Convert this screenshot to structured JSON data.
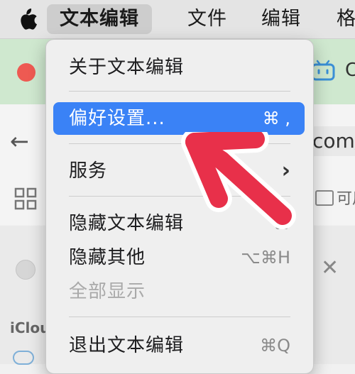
{
  "menubar": {
    "items": [
      "文本编辑",
      "文件",
      "编辑",
      "格"
    ]
  },
  "background": {
    "tab_text": "C",
    "url_text": "com/",
    "available_text": "可用"
  },
  "sidebar": {
    "icloud_label": "iClou"
  },
  "menu": {
    "about": "关于文本编辑",
    "preferences": "偏好设置...",
    "preferences_shortcut": "⌘ ,",
    "services": "服务",
    "services_chevron": "›",
    "hide_app": "隐藏文本编辑",
    "hide_app_shortcut": "⌘",
    "hide_others": "隐藏其他",
    "hide_others_shortcut": "⌥⌘H",
    "show_all": "全部显示",
    "quit": "退出文本编辑",
    "quit_shortcut": "⌘Q"
  },
  "colors": {
    "highlight": "#3a82f6",
    "annotation_arrow": "#e8304a",
    "title_bar": "#cfe8cf"
  }
}
